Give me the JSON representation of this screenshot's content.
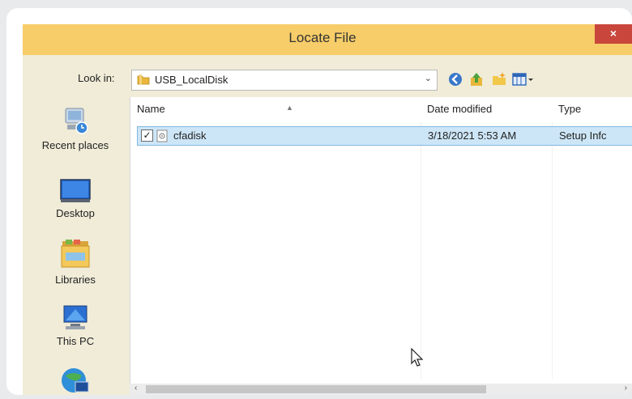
{
  "window": {
    "title": "Locate File",
    "close_label": "×"
  },
  "toolbar": {
    "look_in_label": "Look in:",
    "look_in_value": "USB_LocalDisk",
    "dropdown_arrow": "⌄",
    "icons": [
      "back-icon",
      "up-folder-icon",
      "new-folder-icon",
      "view-menu-icon"
    ]
  },
  "places": [
    {
      "label": "Recent places",
      "icon": "recent-places-icon"
    },
    {
      "label": "Desktop",
      "icon": "desktop-icon"
    },
    {
      "label": "Libraries",
      "icon": "libraries-icon"
    },
    {
      "label": "This PC",
      "icon": "this-pc-icon"
    },
    {
      "label": "",
      "icon": "network-icon"
    }
  ],
  "file_list": {
    "columns": [
      "Name",
      "Date modified",
      "Type"
    ],
    "rows": [
      {
        "checked": true,
        "check_glyph": "✓",
        "name": "cfadisk",
        "date_modified": "3/18/2021 5:53 AM",
        "type": "Setup Infc"
      }
    ]
  },
  "scrollbar": {
    "left_arrow": "‹",
    "right_arrow": "›"
  },
  "colors": {
    "titlebar": "#f6cd68",
    "close": "#c9463d",
    "selection": "#cde6f7"
  }
}
